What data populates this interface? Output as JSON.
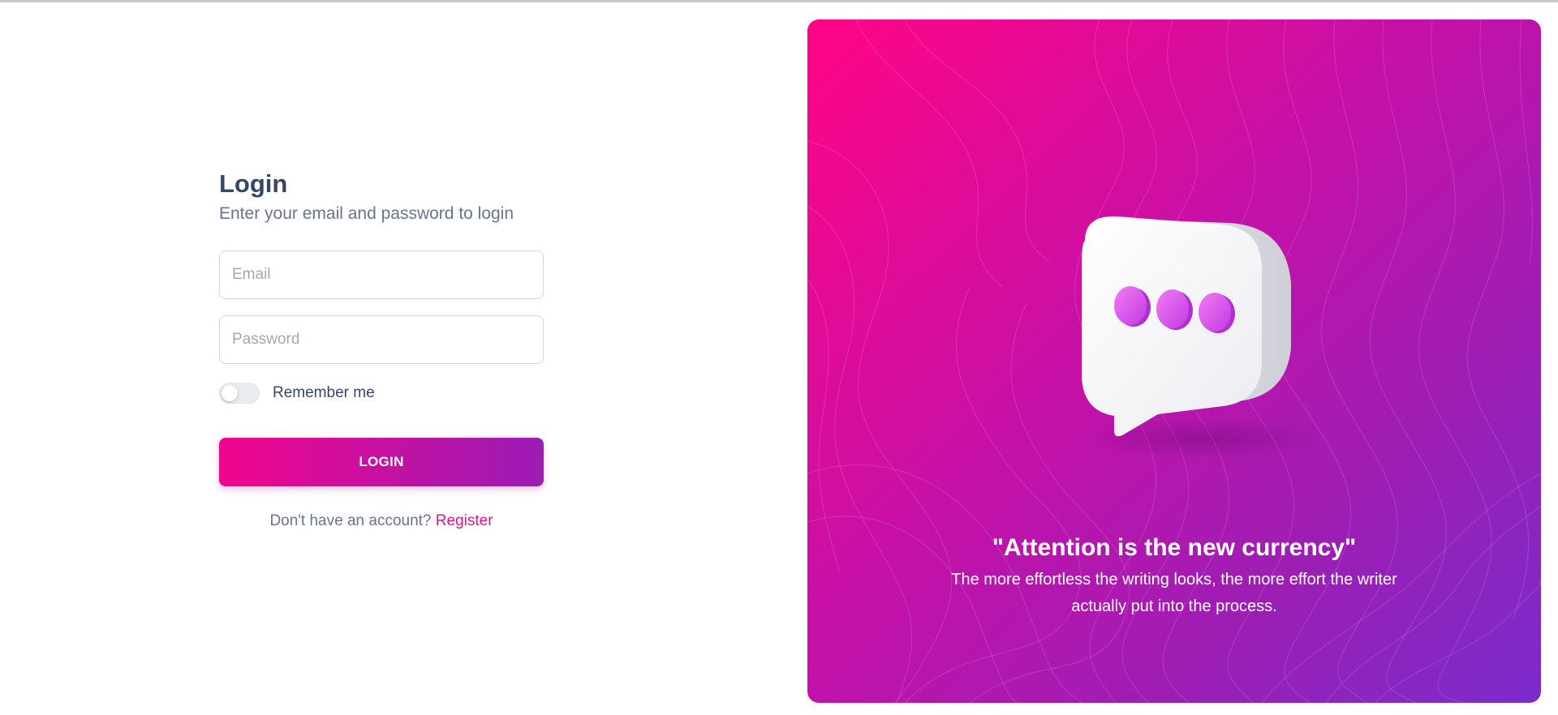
{
  "login": {
    "title": "Login",
    "subtitle": "Enter your email and password to login",
    "email_placeholder": "Email",
    "password_placeholder": "Password",
    "remember_label": "Remember me",
    "remember_checked": false,
    "button_label": "LOGIN",
    "register_prompt": "Don't have an account?",
    "register_link": "Register"
  },
  "hero": {
    "quote_title": "\"Attention is the new currency\"",
    "quote_text": "The more effortless the writing looks, the more effort the writer actually put into the process.",
    "illustration": "chat-bubble-icon"
  },
  "colors": {
    "accent": "#e0128f",
    "gradient_start": "#ff0585",
    "gradient_end": "#7a2ccc",
    "title_text": "#344767",
    "muted_text": "#67748e"
  }
}
